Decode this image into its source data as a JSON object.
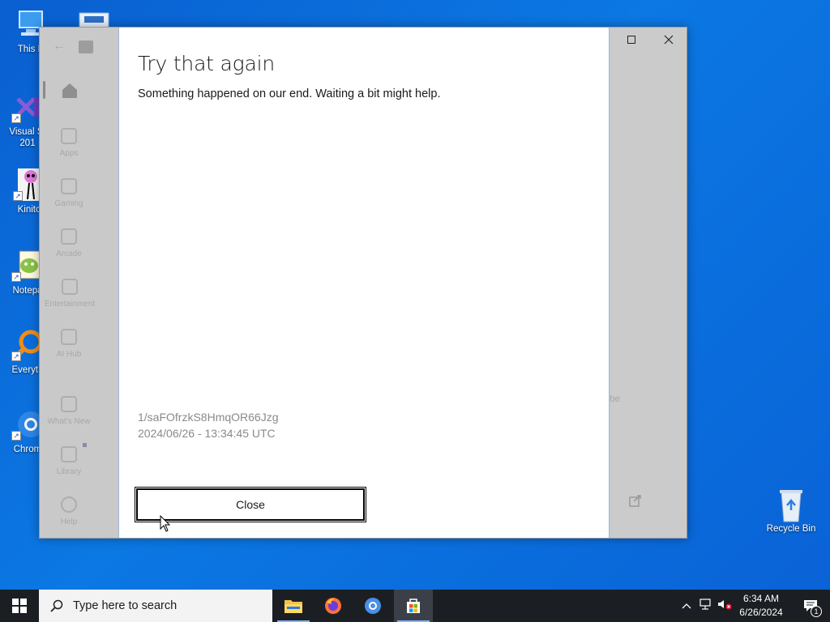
{
  "desktop": {
    "icons": [
      {
        "label": "This P",
        "icon": "computer-icon"
      },
      {
        "label": "Visual St",
        "label2": "201",
        "icon": "visual-studio-icon"
      },
      {
        "label": "Kinito",
        "icon": "kinito-icon"
      },
      {
        "label": "Notepa",
        "icon": "notepad-plus-icon"
      },
      {
        "label": "Everyth",
        "icon": "everything-search-icon"
      },
      {
        "label": "Chrom",
        "icon": "chromium-icon"
      },
      {
        "label": "Recycle Bin",
        "icon": "recycle-bin-icon"
      }
    ]
  },
  "store_window": {
    "nav": [
      {
        "label": "Apps",
        "icon": "apps-icon"
      },
      {
        "label": "Gaming",
        "icon": "gaming-icon"
      },
      {
        "label": "Arcade",
        "icon": "arcade-icon"
      },
      {
        "label": "Entertainment",
        "icon": "entertainment-icon"
      },
      {
        "label": "AI Hub",
        "icon": "ai-hub-icon"
      },
      {
        "label": "What's New",
        "icon": "whats-new-icon"
      },
      {
        "label": "Library",
        "icon": "library-icon"
      },
      {
        "label": "Help",
        "icon": "help-icon"
      }
    ],
    "background_text": "be"
  },
  "dialog": {
    "title": "Try that again",
    "message": "Something happened on our end. Waiting a bit might help.",
    "code": "1/saFOfrzkS8HmqOR66Jzg",
    "timestamp": "2024/06/26 - 13:34:45 UTC",
    "close_label": "Close"
  },
  "taskbar": {
    "search_placeholder": "Type here to search",
    "apps": [
      "file-explorer-icon",
      "firefox-icon",
      "chromium-icon",
      "microsoft-store-icon"
    ],
    "clock_time": "6:34 AM",
    "clock_date": "6/26/2024",
    "notification_count": "1"
  },
  "colors": {
    "desktop": "#0b78e3",
    "taskbar": "#1b1f24",
    "dialog_bg": "#ffffff"
  }
}
